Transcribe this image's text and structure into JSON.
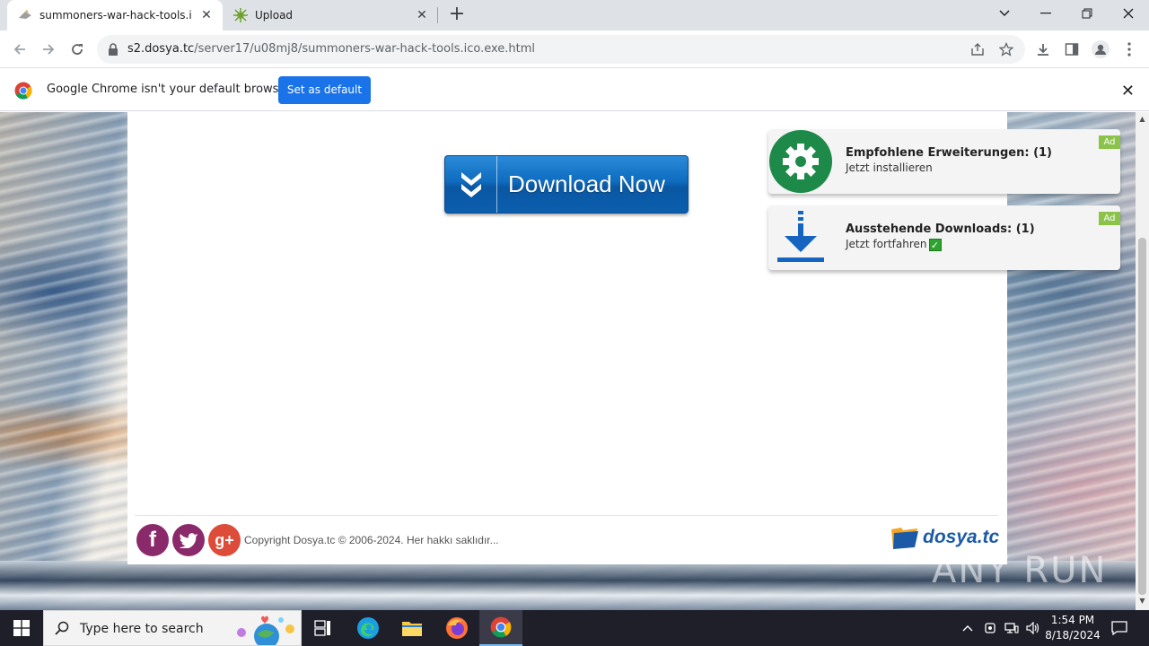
{
  "browser": {
    "tabs": [
      {
        "title": "summoners-war-hack-tools.ico.exe.html",
        "active": true
      },
      {
        "title": "Upload",
        "active": false
      }
    ],
    "url_host": "s2.dosya.tc",
    "url_path": "/server17/u08mj8/summoners-war-hack-tools.ico.exe.html"
  },
  "infobar": {
    "message": "Google Chrome isn't your default browser",
    "button": "Set as default"
  },
  "page": {
    "download_button": "Download Now",
    "ads": [
      {
        "title": "Empfohlene Erweiterungen: (1)",
        "subtitle": "Jetzt installieren",
        "tag": "Ad",
        "icon": "gear-icon",
        "icon_color": "#1e8a4a"
      },
      {
        "title": "Ausstehende Downloads: (1)",
        "subtitle": "Jetzt fortfahren",
        "tag": "Ad",
        "icon": "download-arrow-icon",
        "icon_color": "#1565c0"
      }
    ],
    "footer": {
      "social": [
        {
          "name": "facebook",
          "glyph": "f",
          "color": "#8b2a6b"
        },
        {
          "name": "twitter",
          "glyph": "t",
          "color": "#8b2a6b"
        },
        {
          "name": "google-plus",
          "glyph": "g+",
          "color": "#dd4b39"
        }
      ],
      "copyright": "Copyright Dosya.tc © 2006-2024. Her hakkı saklıdır...",
      "brand": "dosya.tc"
    },
    "watermark": "ANY RUN"
  },
  "taskbar": {
    "search_placeholder": "Type here to search",
    "time": "1:54 PM",
    "date": "8/18/2024"
  },
  "colors": {
    "accent_blue": "#1a73e8",
    "download_blue": "#0f6cbf",
    "ad_tag_green": "#8bc34a"
  }
}
